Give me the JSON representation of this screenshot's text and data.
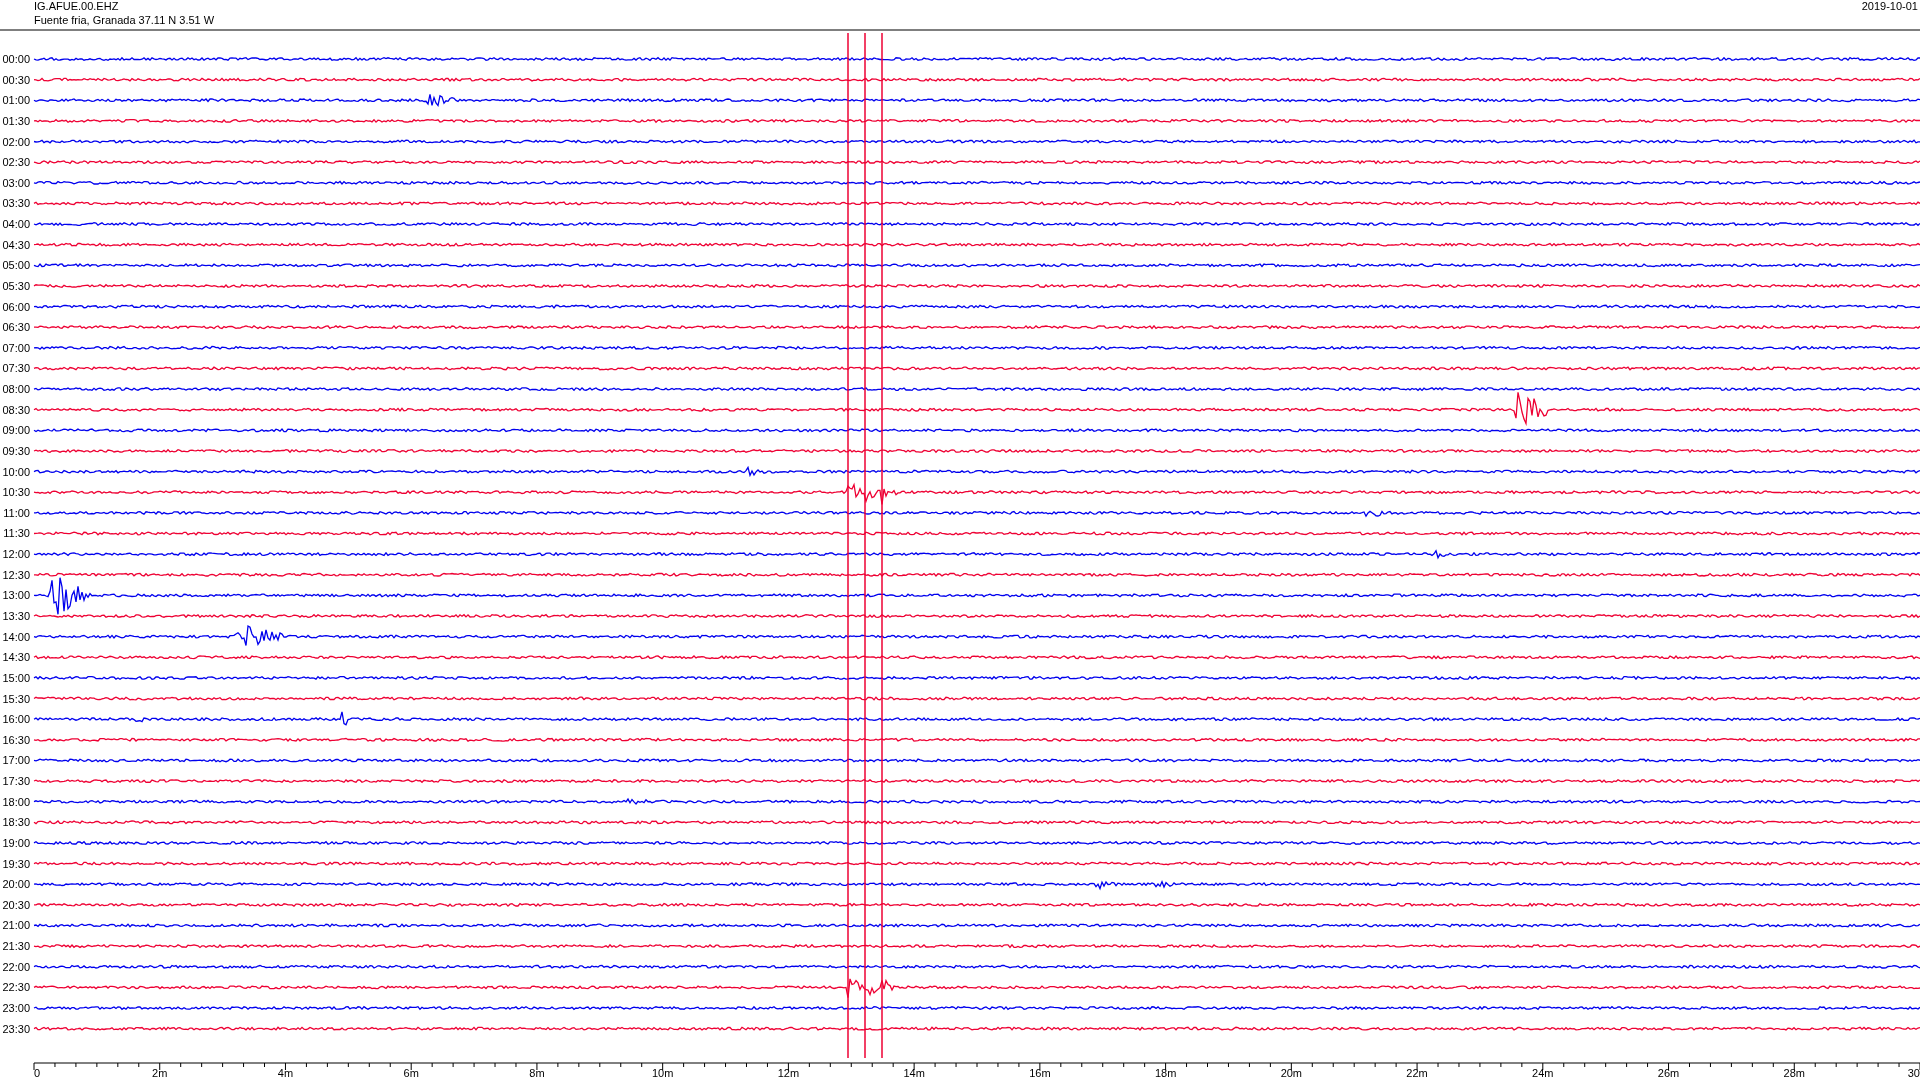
{
  "header": {
    "station": "IG.AFUE.00.EHZ",
    "location": "Fuente fria, Granada  37.11 N 3.51 W",
    "date": "2019-10-01"
  },
  "rows": [
    {
      "label": "00:00",
      "color": "#0000ee"
    },
    {
      "label": "00:30",
      "color": "#ee0033"
    },
    {
      "label": "01:00",
      "color": "#0000ee"
    },
    {
      "label": "01:30",
      "color": "#ee0033"
    },
    {
      "label": "02:00",
      "color": "#0000ee"
    },
    {
      "label": "02:30",
      "color": "#ee0033"
    },
    {
      "label": "03:00",
      "color": "#0000ee"
    },
    {
      "label": "03:30",
      "color": "#ee0033"
    },
    {
      "label": "04:00",
      "color": "#0000ee"
    },
    {
      "label": "04:30",
      "color": "#ee0033"
    },
    {
      "label": "05:00",
      "color": "#0000ee"
    },
    {
      "label": "05:30",
      "color": "#ee0033"
    },
    {
      "label": "06:00",
      "color": "#0000ee"
    },
    {
      "label": "06:30",
      "color": "#ee0033"
    },
    {
      "label": "07:00",
      "color": "#0000ee"
    },
    {
      "label": "07:30",
      "color": "#ee0033"
    },
    {
      "label": "08:00",
      "color": "#0000ee"
    },
    {
      "label": "08:30",
      "color": "#ee0033"
    },
    {
      "label": "09:00",
      "color": "#0000ee"
    },
    {
      "label": "09:30",
      "color": "#ee0033"
    },
    {
      "label": "10:00",
      "color": "#0000ee"
    },
    {
      "label": "10:30",
      "color": "#ee0033"
    },
    {
      "label": "11:00",
      "color": "#0000ee"
    },
    {
      "label": "11:30",
      "color": "#ee0033"
    },
    {
      "label": "12:00",
      "color": "#0000ee"
    },
    {
      "label": "12:30",
      "color": "#ee0033"
    },
    {
      "label": "13:00",
      "color": "#0000ee"
    },
    {
      "label": "13:30",
      "color": "#ee0033"
    },
    {
      "label": "14:00",
      "color": "#0000ee"
    },
    {
      "label": "14:30",
      "color": "#ee0033"
    },
    {
      "label": "15:00",
      "color": "#0000ee"
    },
    {
      "label": "15:30",
      "color": "#ee0033"
    },
    {
      "label": "16:00",
      "color": "#0000ee"
    },
    {
      "label": "16:30",
      "color": "#ee0033"
    },
    {
      "label": "17:00",
      "color": "#0000ee"
    },
    {
      "label": "17:30",
      "color": "#ee0033"
    },
    {
      "label": "18:00",
      "color": "#0000ee"
    },
    {
      "label": "18:30",
      "color": "#ee0033"
    },
    {
      "label": "19:00",
      "color": "#0000ee"
    },
    {
      "label": "19:30",
      "color": "#ee0033"
    },
    {
      "label": "20:00",
      "color": "#0000ee"
    },
    {
      "label": "20:30",
      "color": "#ee0033"
    },
    {
      "label": "21:00",
      "color": "#0000ee"
    },
    {
      "label": "21:30",
      "color": "#ee0033"
    },
    {
      "label": "22:00",
      "color": "#0000ee"
    },
    {
      "label": "22:30",
      "color": "#ee0033"
    },
    {
      "label": "23:00",
      "color": "#0000ee"
    },
    {
      "label": "23:30",
      "color": "#ee0033"
    }
  ],
  "x_axis": {
    "tick_labels": [
      "0",
      "2m",
      "4m",
      "6m",
      "8m",
      "10m",
      "12m",
      "14m",
      "16m",
      "18m",
      "20m",
      "22m",
      "24m",
      "26m",
      "28m",
      "30"
    ]
  }
}
